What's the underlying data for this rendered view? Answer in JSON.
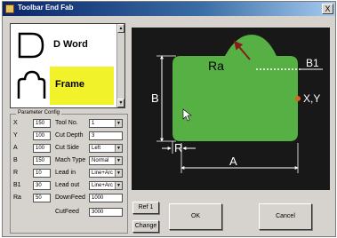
{
  "window": {
    "title": "Toolbar End Fab",
    "close_label": "X"
  },
  "shape_list": {
    "items": [
      {
        "label": "D Word",
        "icon": "d-shape-icon"
      },
      {
        "label": "Frame",
        "icon": "frame-shape-icon"
      }
    ],
    "selected": "Frame",
    "highlight_color": "#f2f22a"
  },
  "param_config": {
    "title": "Parameter Config",
    "left_fields": [
      {
        "label": "X",
        "value": "150"
      },
      {
        "label": "Y",
        "value": "100"
      },
      {
        "label": "A",
        "value": "100"
      },
      {
        "label": "B",
        "value": "150"
      },
      {
        "label": "R",
        "value": "10"
      },
      {
        "label": "B1",
        "value": "30"
      },
      {
        "label": "Ra",
        "value": "50"
      }
    ],
    "right_fields": [
      {
        "label": "Tool No.",
        "value": "1",
        "type": "select"
      },
      {
        "label": "Cut Depth",
        "value": "3",
        "type": "input"
      },
      {
        "label": "Cut Side",
        "value": "Left",
        "type": "select"
      },
      {
        "label": "Mach Type",
        "value": "Normal",
        "type": "select"
      },
      {
        "label": "Lead in",
        "value": "Line+Arc",
        "type": "select"
      },
      {
        "label": "Lead out",
        "value": "Line+Arc",
        "type": "select"
      },
      {
        "label": "DownFeed",
        "value": "1000",
        "type": "input"
      },
      {
        "label": "CutFeed",
        "value": "3000",
        "type": "input"
      }
    ]
  },
  "preview": {
    "background": "#181818",
    "shape_color": "#56b044",
    "arrow_color": "#8b1a1a",
    "labels": {
      "ra": "Ra",
      "b1": "B1",
      "b": "B",
      "r": "R",
      "a": "A",
      "xy": "X,Y"
    }
  },
  "buttons": {
    "ref": "Ref 1",
    "change": "Change",
    "ok": "OK",
    "cancel": "Cancel"
  }
}
